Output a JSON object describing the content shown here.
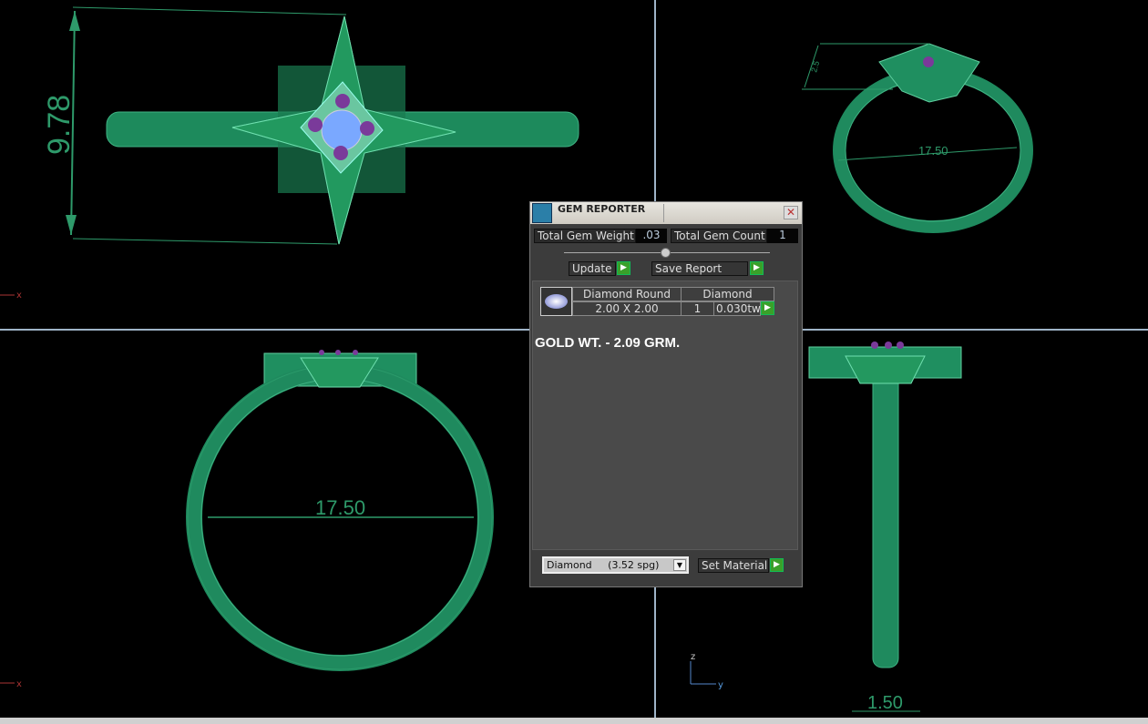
{
  "viewports": {
    "top_left": {
      "dimension": "9.78",
      "axis": "x"
    },
    "top_right": {
      "dimension_small": "2.5",
      "dimension": "17.50"
    },
    "bottom_left": {
      "dimension": "17.50",
      "axis": "x"
    },
    "bottom_right": {
      "dimension": "1.50",
      "axis_z": "z",
      "axis_y": "y"
    }
  },
  "dialog": {
    "title": "GEM REPORTER",
    "close": "✕",
    "total_gem_weight_label": "Total Gem Weight",
    "total_gem_weight": ".03",
    "total_gem_count_label": "Total Gem Count",
    "total_gem_count": "1",
    "update_label": "Update",
    "save_report_label": "Save Report",
    "gem": {
      "shape": "Diamond Round",
      "material": "Diamond",
      "size": "2.00 X 2.00",
      "count": "1",
      "weight": "0.030tw"
    },
    "note": "GOLD WT. - 2.09 GRM.",
    "material_select": "Diamond     (3.52 spg)",
    "set_material_label": "Set Material",
    "go_icon": "▶"
  },
  "colors": {
    "metal": "#1f8a5e",
    "gem": "#6a3a9a",
    "dim": "#2e9a6a"
  }
}
